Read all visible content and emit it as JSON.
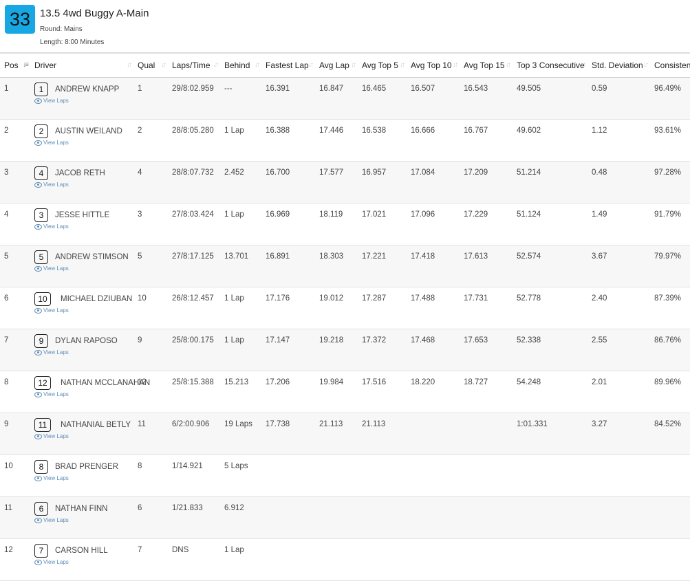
{
  "race": {
    "number": "33",
    "title": "13.5 4wd Buggy A-Main",
    "round": "Round: Mains",
    "length": "Length: 8:00 Minutes"
  },
  "columns": [
    "Pos",
    "Driver",
    "Qual",
    "Laps/Time",
    "Behind",
    "Fastest Lap",
    "Avg Lap",
    "Avg Top 5",
    "Avg Top 10",
    "Avg Top 15",
    "Top 3 Consecutive",
    "Std. Deviation",
    "Consistency"
  ],
  "view_laps_label": "View Laps",
  "rows": [
    {
      "pos": "1",
      "car": "1",
      "driver": "ANDREW KNAPP",
      "qual": "1",
      "laps": "29/8:02.959",
      "behind": "---",
      "fastest": "16.391",
      "avg": "16.847",
      "top5": "16.465",
      "top10": "16.507",
      "top15": "16.543",
      "top3c": "49.505",
      "std": "0.59",
      "cons": "96.49%"
    },
    {
      "pos": "2",
      "car": "2",
      "driver": "AUSTIN WEILAND",
      "qual": "2",
      "laps": "28/8:05.280",
      "behind": "1 Lap",
      "fastest": "16.388",
      "avg": "17.446",
      "top5": "16.538",
      "top10": "16.666",
      "top15": "16.767",
      "top3c": "49.602",
      "std": "1.12",
      "cons": "93.61%"
    },
    {
      "pos": "3",
      "car": "4",
      "driver": "JACOB RETH",
      "qual": "4",
      "laps": "28/8:07.732",
      "behind": "2.452",
      "fastest": "16.700",
      "avg": "17.577",
      "top5": "16.957",
      "top10": "17.084",
      "top15": "17.209",
      "top3c": "51.214",
      "std": "0.48",
      "cons": "97.28%"
    },
    {
      "pos": "4",
      "car": "3",
      "driver": "JESSE HITTLE",
      "qual": "3",
      "laps": "27/8:03.424",
      "behind": "1 Lap",
      "fastest": "16.969",
      "avg": "18.119",
      "top5": "17.021",
      "top10": "17.096",
      "top15": "17.229",
      "top3c": "51.124",
      "std": "1.49",
      "cons": "91.79%"
    },
    {
      "pos": "5",
      "car": "5",
      "driver": "ANDREW STIMSON",
      "qual": "5",
      "laps": "27/8:17.125",
      "behind": "13.701",
      "fastest": "16.891",
      "avg": "18.303",
      "top5": "17.221",
      "top10": "17.418",
      "top15": "17.613",
      "top3c": "52.574",
      "std": "3.67",
      "cons": "79.97%"
    },
    {
      "pos": "6",
      "car": "10",
      "driver": "MICHAEL DZIUBAN",
      "qual": "10",
      "laps": "26/8:12.457",
      "behind": "1 Lap",
      "fastest": "17.176",
      "avg": "19.012",
      "top5": "17.287",
      "top10": "17.488",
      "top15": "17.731",
      "top3c": "52.778",
      "std": "2.40",
      "cons": "87.39%"
    },
    {
      "pos": "7",
      "car": "9",
      "driver": "DYLAN RAPOSO",
      "qual": "9",
      "laps": "25/8:00.175",
      "behind": "1 Lap",
      "fastest": "17.147",
      "avg": "19.218",
      "top5": "17.372",
      "top10": "17.468",
      "top15": "17.653",
      "top3c": "52.338",
      "std": "2.55",
      "cons": "86.76%"
    },
    {
      "pos": "8",
      "car": "12",
      "driver": "NATHAN MCCLANAHAN",
      "qual": "12",
      "laps": "25/8:15.388",
      "behind": "15.213",
      "fastest": "17.206",
      "avg": "19.984",
      "top5": "17.516",
      "top10": "18.220",
      "top15": "18.727",
      "top3c": "54.248",
      "std": "2.01",
      "cons": "89.96%"
    },
    {
      "pos": "9",
      "car": "11",
      "driver": "NATHANIAL BETLY",
      "qual": "11",
      "laps": "6/2:00.906",
      "behind": "19 Laps",
      "fastest": "17.738",
      "avg": "21.113",
      "top5": "21.113",
      "top10": "",
      "top15": "",
      "top3c": "1:01.331",
      "std": "3.27",
      "cons": "84.52%"
    },
    {
      "pos": "10",
      "car": "8",
      "driver": "BRAD PRENGER",
      "qual": "8",
      "laps": "1/14.921",
      "behind": "5 Laps",
      "fastest": "",
      "avg": "",
      "top5": "",
      "top10": "",
      "top15": "",
      "top3c": "",
      "std": "",
      "cons": ""
    },
    {
      "pos": "11",
      "car": "6",
      "driver": "NATHAN FINN",
      "qual": "6",
      "laps": "1/21.833",
      "behind": "6.912",
      "fastest": "",
      "avg": "",
      "top5": "",
      "top10": "",
      "top15": "",
      "top3c": "",
      "std": "",
      "cons": ""
    },
    {
      "pos": "12",
      "car": "7",
      "driver": "CARSON HILL",
      "qual": "7",
      "laps": "DNS",
      "behind": "1 Lap",
      "fastest": "",
      "avg": "",
      "top5": "",
      "top10": "",
      "top15": "",
      "top3c": "",
      "std": "",
      "cons": ""
    }
  ]
}
